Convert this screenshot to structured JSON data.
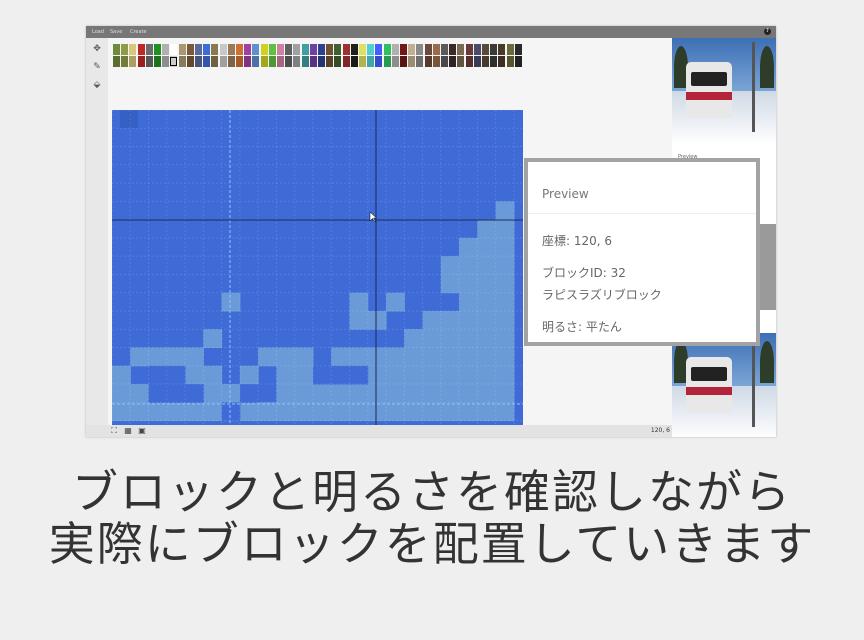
{
  "menu": [
    "Load",
    "Save",
    "Create"
  ],
  "colors": {
    "canvas_blue": "#3f6bd6",
    "light_blue": "#6a9bd8",
    "palette": [
      "#6f8a3b",
      "#8f9b4a",
      "#d8c77a",
      "#c02828",
      "#6b6b6b",
      "#209020",
      "#b0b0b0",
      "#ffffff",
      "#a89a70",
      "#7a5a3a",
      "#5a6a9a",
      "#3f6bd6",
      "#8a7a50",
      "#c8c8c8",
      "#9a7a5a",
      "#d07030",
      "#a040a0",
      "#6090d0",
      "#d0d020",
      "#60c040",
      "#d080a0",
      "#606060",
      "#a0a0a0",
      "#40a0a0",
      "#7040a0",
      "#304090",
      "#705030",
      "#406030",
      "#a03030",
      "#202020",
      "#e0e060",
      "#50d0d0",
      "#4060ff",
      "#30c060",
      "#b0b0b0",
      "#701818",
      "#c0b090",
      "#8a8a8a",
      "#6a4a3a",
      "#9a6a4a",
      "#5a5a5a",
      "#3a2a2a",
      "#7a6a50",
      "#6a3a3a",
      "#4a4a6a",
      "#5a4a3a",
      "#3a3a3a",
      "#4a3a2a",
      "#6a6a3a",
      "#2a2a2a"
    ]
  },
  "tools": {
    "move_icon": "move-icon",
    "pencil_icon": "pencil-icon",
    "fill_icon": "fill-bucket-icon"
  },
  "status": {
    "coord": "120, 6"
  },
  "right_panel": {
    "preview_label": "Preview"
  },
  "popup": {
    "title": "Preview",
    "coord": "座標: 120, 6",
    "block_id": "ブロックID: 32",
    "block_name": "ラピスラズリブロック",
    "brightness": "明るさ: 平たん"
  },
  "caption": {
    "line1": "ブロックと明るさを確認しながら",
    "line2": "実際にブロックを配置していきます"
  }
}
